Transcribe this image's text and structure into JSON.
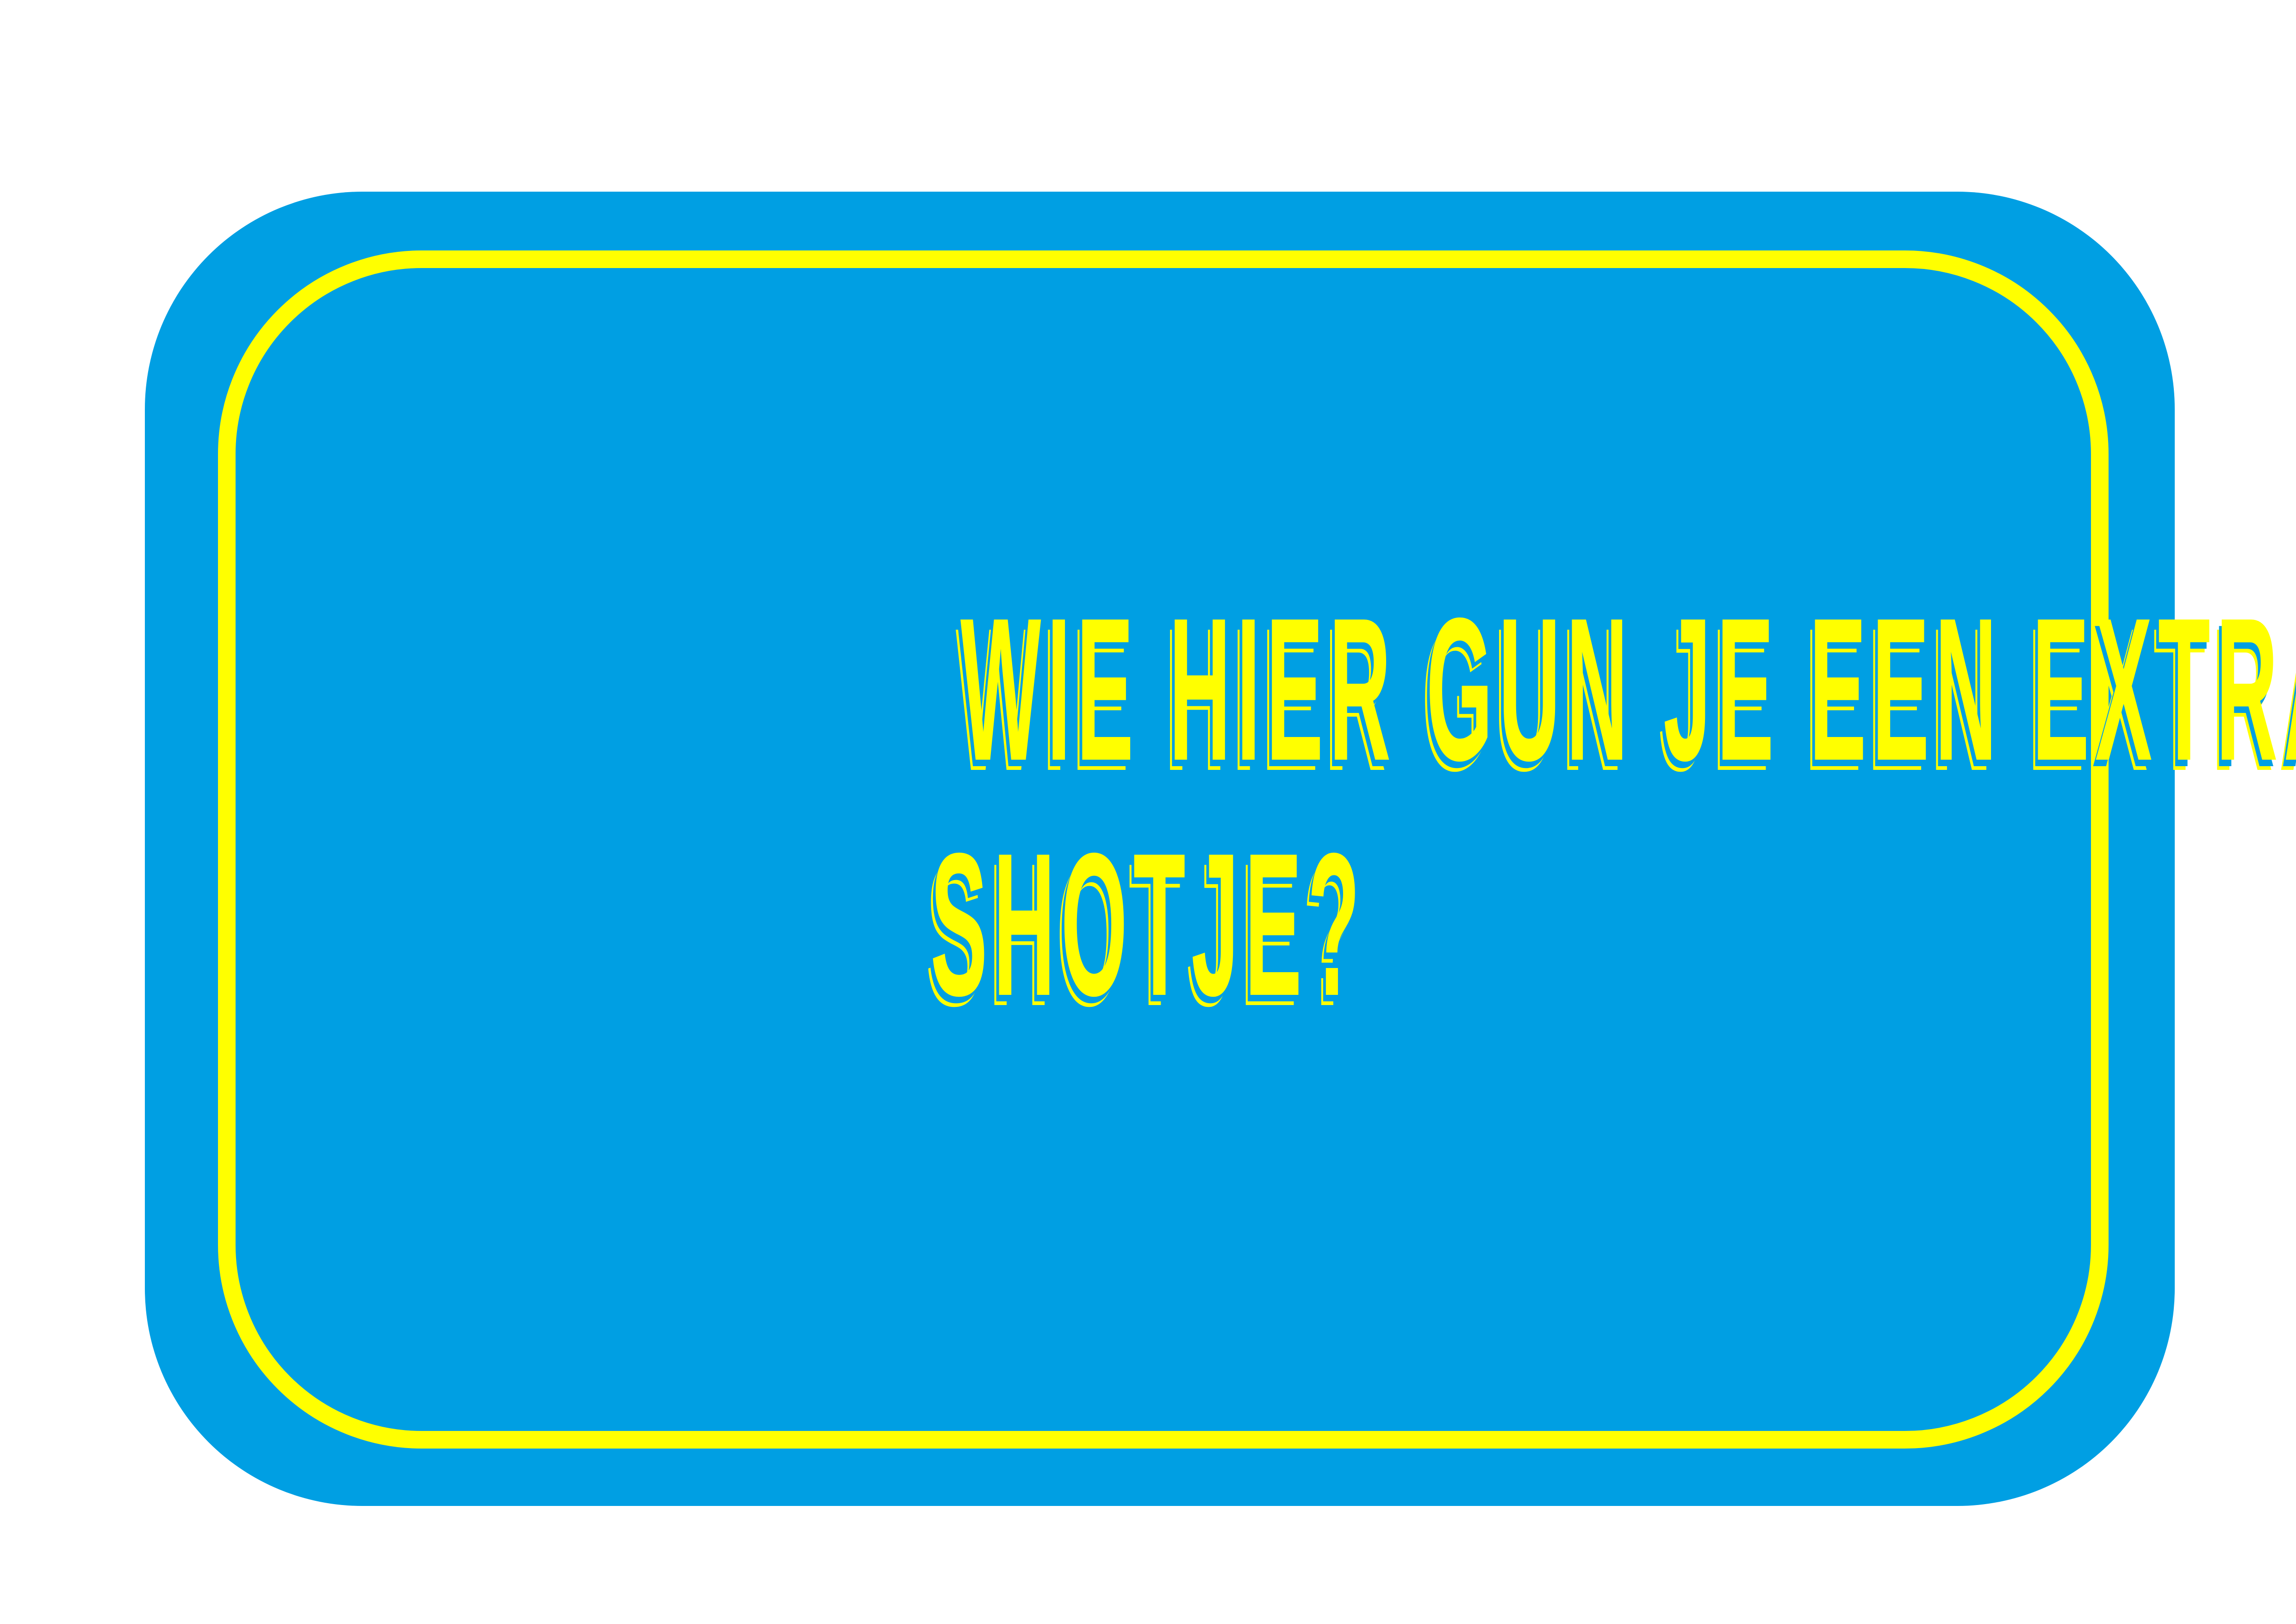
{
  "card": {
    "question_lines": [
      "WIE HIER GUN JE EEN EXTRA",
      "SHOTJE?"
    ],
    "colors": {
      "background": "#009FE3",
      "accent": "#FFFF00"
    }
  }
}
